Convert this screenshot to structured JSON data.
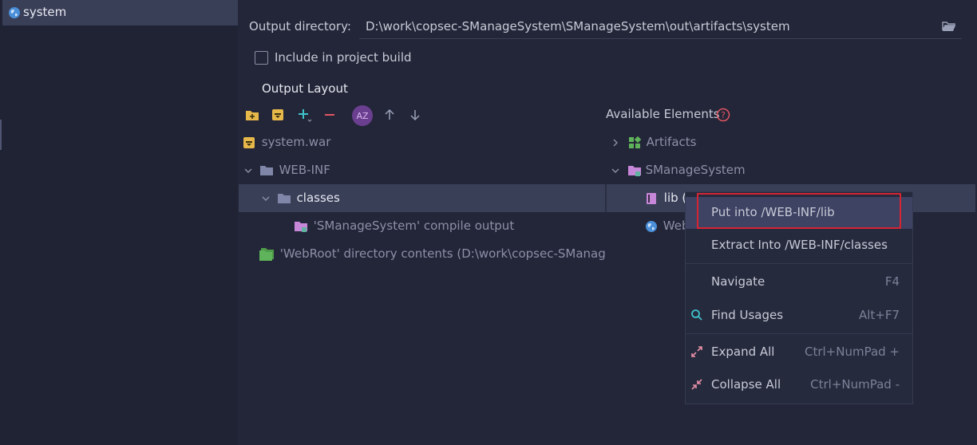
{
  "sidebar": {
    "selected_item": "system"
  },
  "output_directory": {
    "label": "Output directory:",
    "value": "D:\\work\\copsec-SManageSystem\\SManageSystem\\out\\artifacts\\system"
  },
  "include_build": {
    "label": "Include in project build",
    "checked": false
  },
  "output_layout": {
    "title": "Output Layout",
    "toolbar": [
      "new-folder-icon",
      "archive-icon",
      "add-icon",
      "remove-icon",
      "sort-az-icon",
      "arrow-up-icon",
      "arrow-down-icon"
    ],
    "tree": {
      "root": "system.war",
      "web_inf": "WEB-INF",
      "classes": "classes",
      "compile_output": "'SManageSystem' compile output",
      "webroot": "'WebRoot' directory contents (D:\\work\\copsec-SManage"
    }
  },
  "available_elements": {
    "title": "Available Elements",
    "artifacts": "Artifacts",
    "module": "SManageSystem",
    "lib": "lib (",
    "web": "Web"
  },
  "context_menu": {
    "items": [
      {
        "label": "Put into /WEB-INF/lib",
        "shortcut": ""
      },
      {
        "label": "Extract Into /WEB-INF/classes",
        "shortcut": ""
      },
      {
        "label": "Navigate",
        "shortcut": "F4"
      },
      {
        "label": "Find Usages",
        "shortcut": "Alt+F7"
      },
      {
        "label": "Expand All",
        "shortcut": "Ctrl+NumPad +"
      },
      {
        "label": "Collapse All",
        "shortcut": "Ctrl+NumPad -"
      }
    ]
  },
  "colors": {
    "accent_highlight": "#d62433",
    "selection": "#3a3f58",
    "folder": "#7f86a8",
    "module_folder": "#c787d9",
    "artifacts_green": "#5fb35a"
  }
}
